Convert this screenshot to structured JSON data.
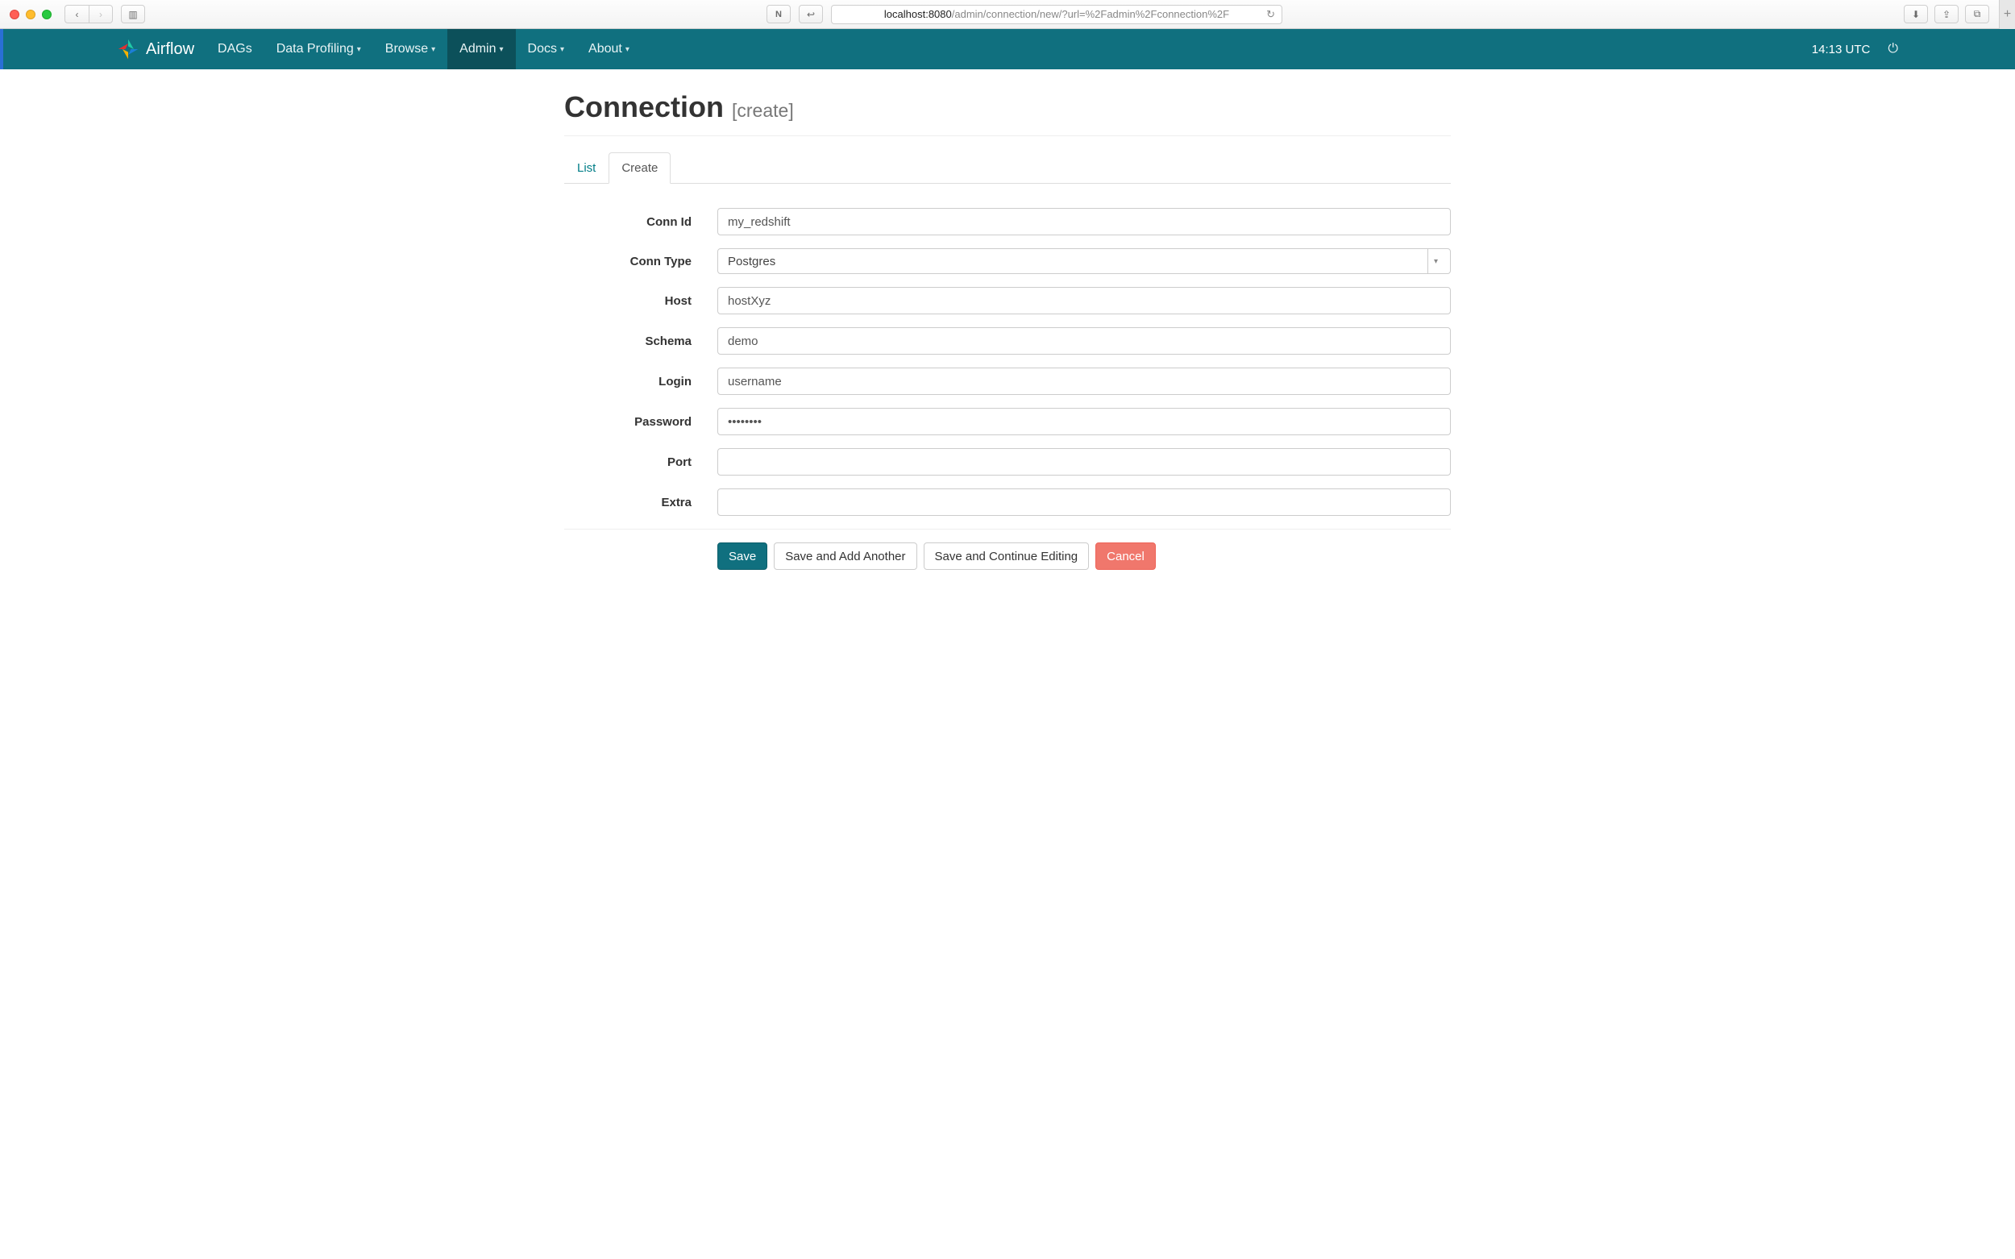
{
  "browser": {
    "url_host": "localhost:8080",
    "url_path": "/admin/connection/new/?url=%2Fadmin%2Fconnection%2F"
  },
  "navbar": {
    "brand": "Airflow",
    "items": [
      {
        "label": "DAGs",
        "caret": false,
        "active": false
      },
      {
        "label": "Data Profiling",
        "caret": true,
        "active": false
      },
      {
        "label": "Browse",
        "caret": true,
        "active": false
      },
      {
        "label": "Admin",
        "caret": true,
        "active": true
      },
      {
        "label": "Docs",
        "caret": true,
        "active": false
      },
      {
        "label": "About",
        "caret": true,
        "active": false
      }
    ],
    "clock": "14:13 UTC"
  },
  "page": {
    "title": "Connection",
    "subtitle": "[create]"
  },
  "tabs": {
    "list": "List",
    "create": "Create"
  },
  "form": {
    "labels": {
      "conn_id": "Conn Id",
      "conn_type": "Conn Type",
      "host": "Host",
      "schema": "Schema",
      "login": "Login",
      "password": "Password",
      "port": "Port",
      "extra": "Extra"
    },
    "values": {
      "conn_id": "my_redshift",
      "conn_type": "Postgres",
      "host": "hostXyz",
      "schema": "demo",
      "login": "username",
      "password": "••••••••",
      "port": "",
      "extra": ""
    }
  },
  "buttons": {
    "save": "Save",
    "save_add": "Save and Add Another",
    "save_continue": "Save and Continue Editing",
    "cancel": "Cancel"
  },
  "glyph": {
    "back": "‹",
    "fwd": "›",
    "sidebar": "▥",
    "note": "N",
    "reply": "↩",
    "reload": "↻",
    "download": "⬇",
    "share": "⇪",
    "tabs": "⧉",
    "plus": "+",
    "caret": "▾",
    "selectcaret": "▾",
    "power": "⏻"
  }
}
